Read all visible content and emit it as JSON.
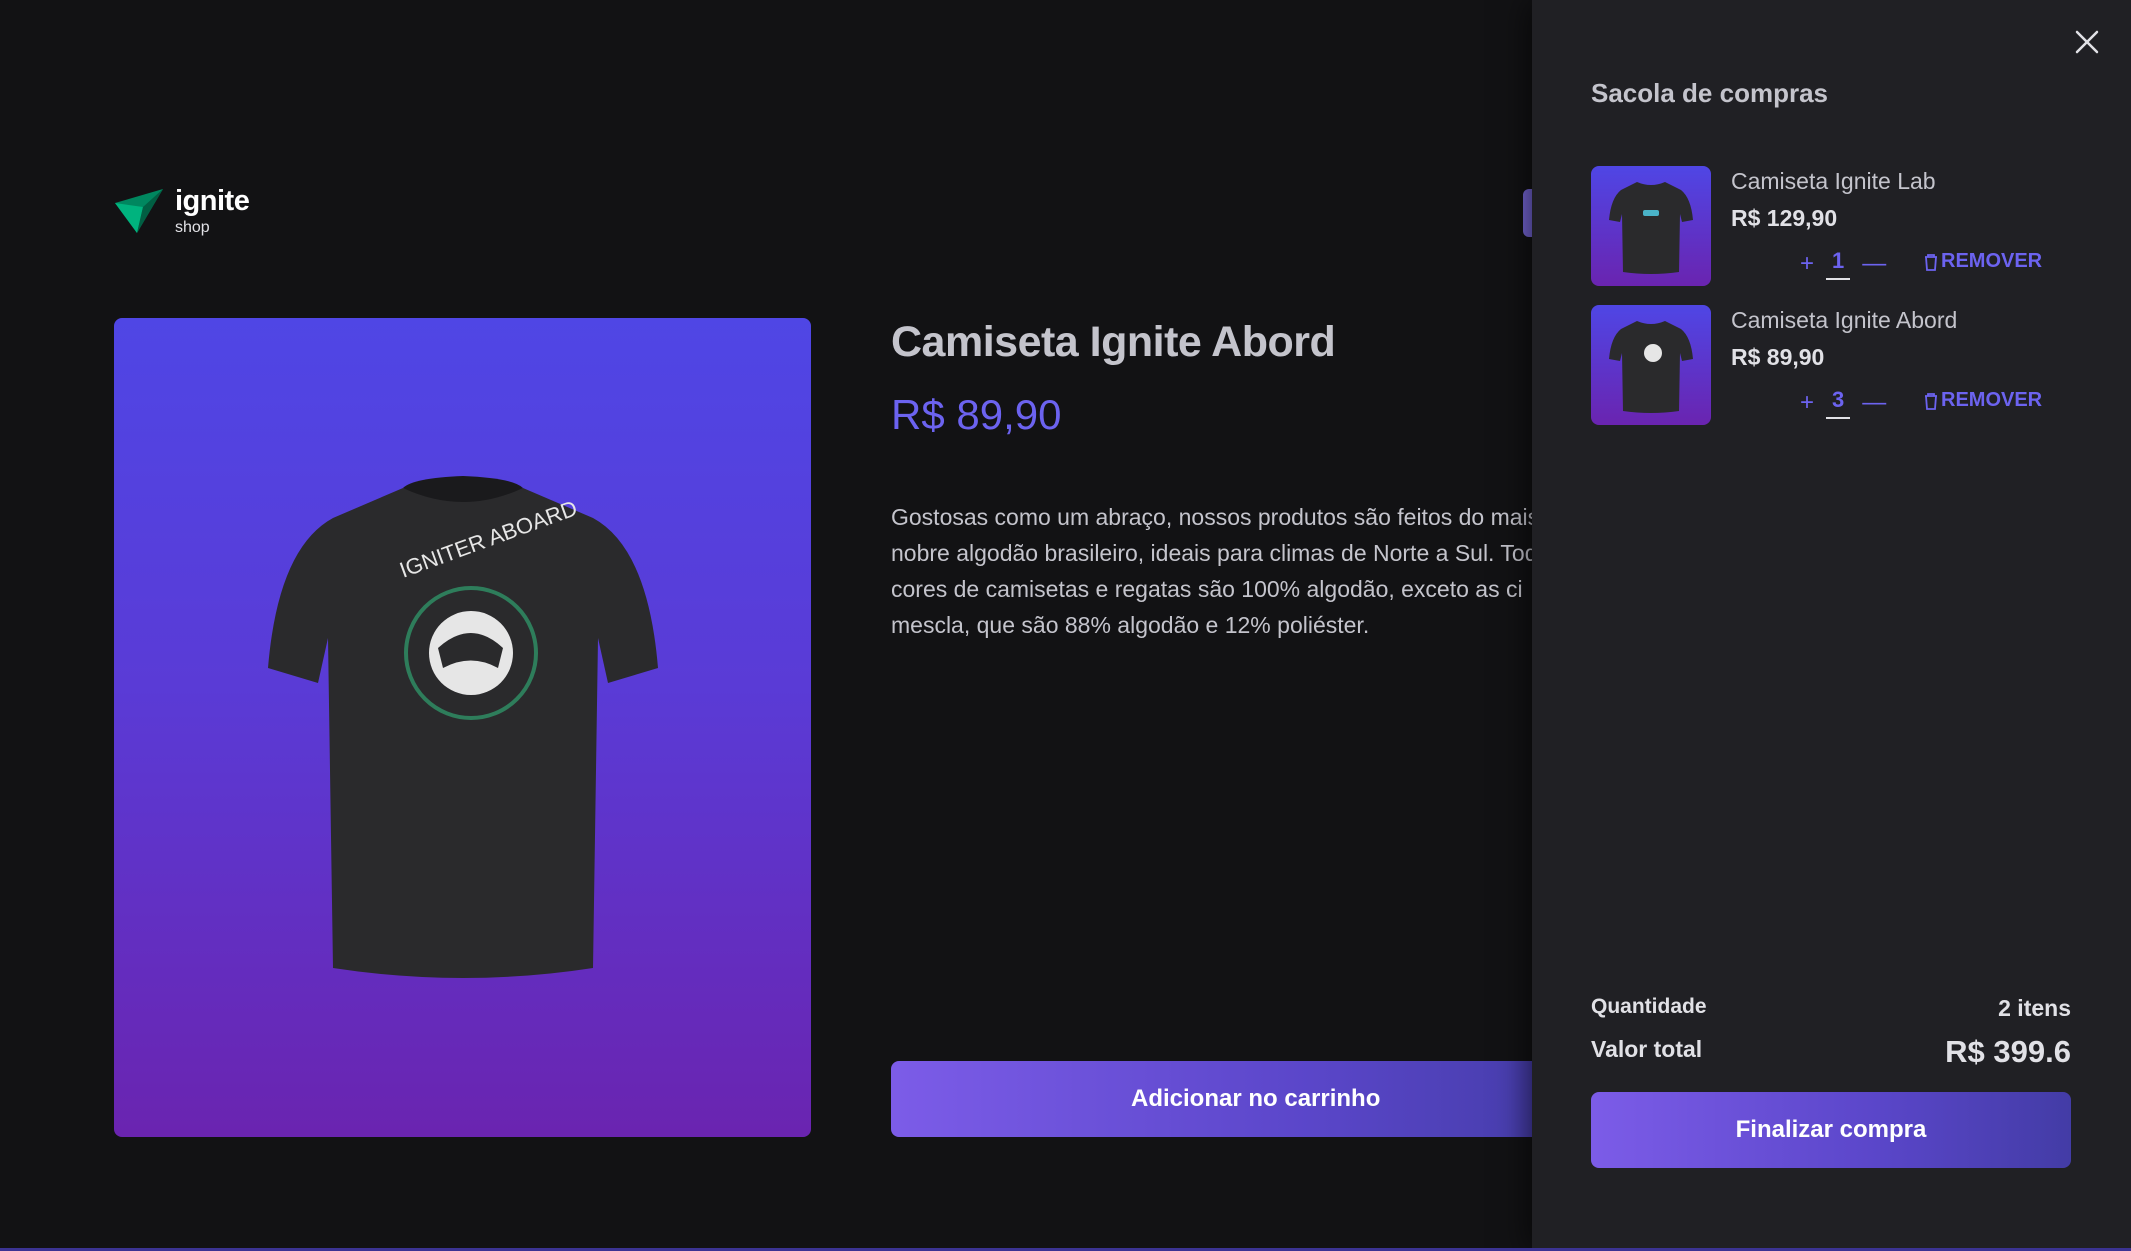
{
  "brand": {
    "name": "ignite",
    "sub": "shop"
  },
  "product": {
    "title": "Camiseta Ignite Abord",
    "price": "R$ 89,90",
    "description": "Gostosas como um abraço, nossos produtos são feitos do mais e nobre algodão brasileiro, ideais para climas de Norte a Sul. Tod as cores de camisetas e regatas são 100% algodão, exceto as ci mescla, que são 88% algodão e 12% poliéster.",
    "add_label": "Adicionar no carrinho"
  },
  "cart": {
    "title": "Sacola de compras",
    "items": [
      {
        "name": "Camiseta Ignite Lab",
        "price": "R$ 129,90",
        "plus": "+",
        "qty": "1",
        "minus": "—",
        "remove": "REMOVER"
      },
      {
        "name": "Camiseta Ignite Abord",
        "price": "R$ 89,90",
        "plus": "+",
        "qty": "3",
        "minus": "—",
        "remove": "REMOVER"
      }
    ],
    "quantity_label": "Quantidade",
    "quantity_value": "2 itens",
    "total_label": "Valor total",
    "total_value": "R$ 399.6",
    "checkout_label": "Finalizar compra"
  },
  "colors": {
    "background": "#121214",
    "drawer": "#202024",
    "accent": "#6c63f0",
    "image_gradient_top": "#4f46e5",
    "image_gradient_bottom": "#6a24b0"
  },
  "icons": {
    "logo": "ignite-logo-icon",
    "close": "close-icon",
    "remove": "trash-icon"
  }
}
